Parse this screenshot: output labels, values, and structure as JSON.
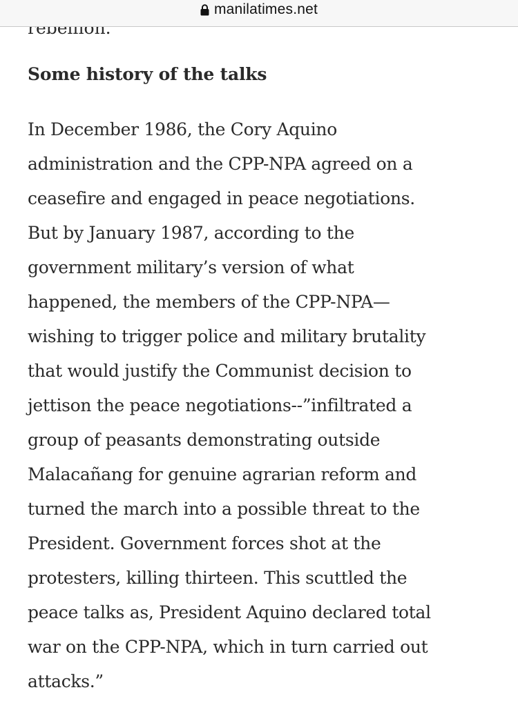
{
  "browser": {
    "url": "manilatimes.net",
    "lock_icon": "lock-icon"
  },
  "article": {
    "cut_off_line": "rebellion.",
    "section_heading": "Some history of the talks",
    "paragraph_lines": [
      "In December 1986, the Cory Aquino",
      "administration and the CPP-NPA agreed on a",
      "ceasefire and engaged in peace negotiations.",
      "But by January 1987, according to the",
      "government military’s version of what",
      "happened, the members of the CPP-NPA—",
      "wishing to trigger police and military brutality",
      "that would justify the Communist decision to",
      "jettison the peace negotiations--”infiltrated a",
      "group of peasants demonstrating outside",
      "Malacañang for genuine agrarian reform and",
      "turned the march into a possible threat to the",
      "President. Government forces shot at the",
      "protesters, killing thirteen. This scuttled the",
      "peace talks as, President Aquino declared total",
      "war on the CPP-NPA, which in turn carried out",
      "attacks.”"
    ]
  }
}
